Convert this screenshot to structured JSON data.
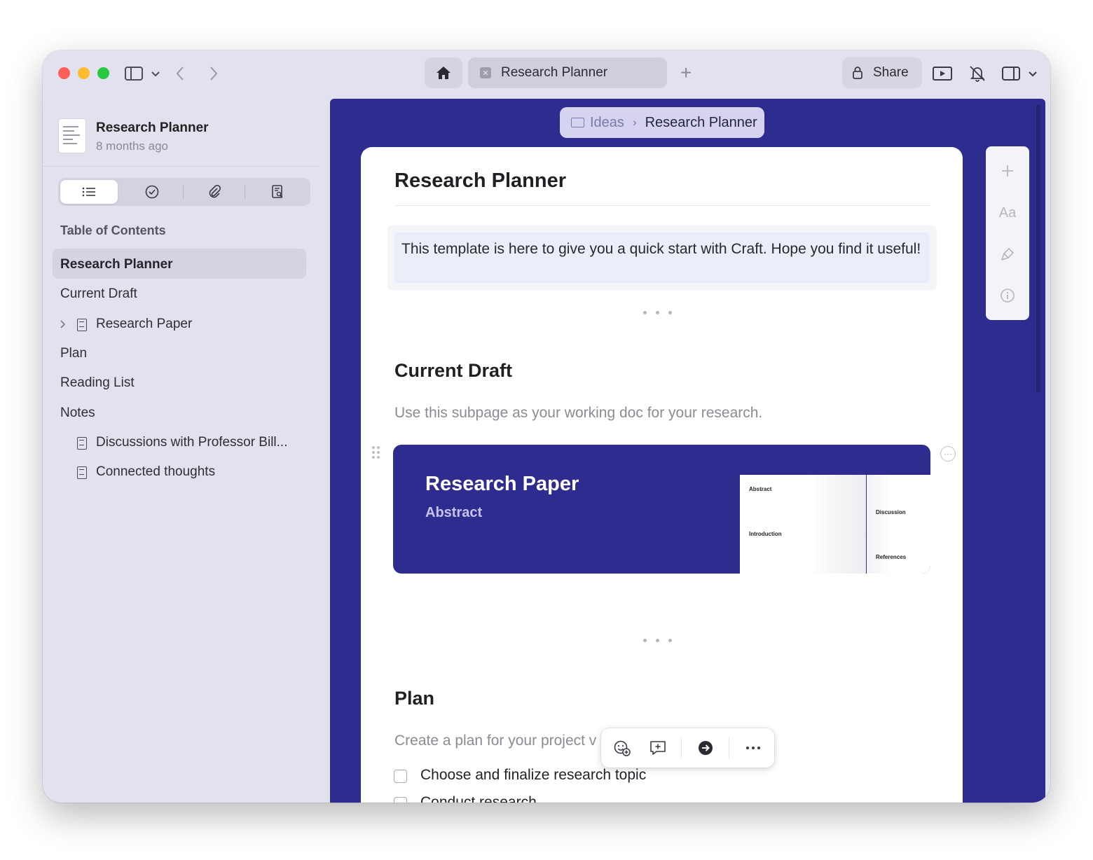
{
  "window": {
    "tab_title": "Research Planner",
    "share_label": "Share"
  },
  "sidebar": {
    "doc_title": "Research Planner",
    "doc_subtitle": "8 months ago",
    "toc_heading": "Table of Contents",
    "toc": [
      {
        "label": "Research Planner",
        "active": true
      },
      {
        "label": "Current Draft"
      },
      {
        "label": "Research Paper",
        "has_page_icon": true,
        "collapsible": true
      },
      {
        "label": "Plan"
      },
      {
        "label": "Reading List"
      },
      {
        "label": "Notes"
      },
      {
        "label": "Discussions with Professor Bill...",
        "has_page_icon": true
      },
      {
        "label": "Connected thoughts",
        "has_page_icon": true
      }
    ],
    "segments": [
      "list-icon",
      "check-circle-icon",
      "paperclip-icon",
      "document-search-icon"
    ]
  },
  "breadcrumb": {
    "parent": "Ideas",
    "current": "Research Planner"
  },
  "page": {
    "title": "Research Planner",
    "callout": "This template is here to give you a quick start with Craft. Hope you find it useful!",
    "current_draft": {
      "heading": "Current Draft",
      "description": "Use this subpage as your working doc for your research."
    },
    "card": {
      "title": "Research Paper",
      "subtitle": "Abstract",
      "preview_labels": [
        "Abstract",
        "Introduction",
        "Discussion",
        "References"
      ]
    },
    "plan": {
      "heading": "Plan",
      "description": "Create a plan for your project v",
      "tasks": [
        {
          "label": "Choose and finalize research topic",
          "checked": false
        },
        {
          "label": "Conduct research",
          "checked": false
        }
      ]
    }
  },
  "floating_toolbar": [
    "add-reaction-icon",
    "add-comment-icon",
    "go-to-icon",
    "more-icon"
  ],
  "right_panel": {
    "font_label": "Aa",
    "icons": [
      "plus-icon",
      "font-icon",
      "brush-icon",
      "info-icon"
    ]
  },
  "colors": {
    "accent": "#2e2d8f",
    "sidebar_bg": "#e2e1ee",
    "page_bg": "#ffffff"
  }
}
